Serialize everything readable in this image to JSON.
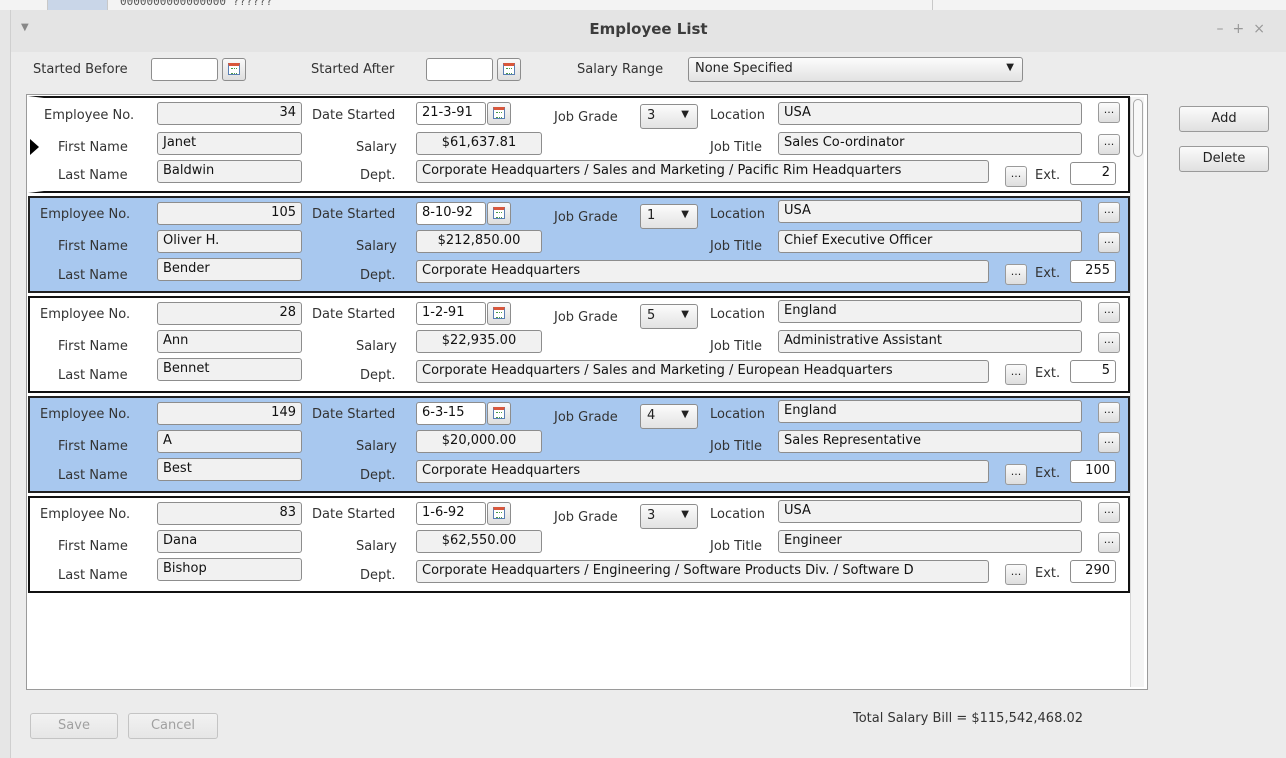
{
  "window": {
    "title": "Employee List",
    "background_fragment": "0000000000000000 ??????"
  },
  "filters": {
    "started_before_label": "Started Before",
    "started_before_value": "",
    "started_after_label": "Started After",
    "started_after_value": "",
    "salary_range_label": "Salary Range",
    "salary_range_value": "None Specified"
  },
  "labels": {
    "employee_no": "Employee No.",
    "first_name": "First Name",
    "last_name": "Last Name",
    "date_started": "Date Started",
    "salary": "Salary",
    "dept": "Dept.",
    "job_grade": "Job Grade",
    "location": "Location",
    "job_title": "Job Title",
    "ext": "Ext.",
    "ellipsis": "..."
  },
  "employees": [
    {
      "emp_no": "34",
      "first_name": "Janet",
      "last_name": "Baldwin",
      "date_started": "21-3-91",
      "salary": "$61,637.81",
      "job_grade": "3",
      "location": "USA",
      "job_title": "Sales Co-ordinator",
      "dept": "Corporate Headquarters / Sales and Marketing / Pacific Rim Headquarters",
      "ext": "2",
      "selected": false
    },
    {
      "emp_no": "105",
      "first_name": "Oliver H.",
      "last_name": "Bender",
      "date_started": "8-10-92",
      "salary": "$212,850.00",
      "job_grade": "1",
      "location": "USA",
      "job_title": "Chief Executive Officer",
      "dept": "Corporate Headquarters",
      "ext": "255",
      "selected": true
    },
    {
      "emp_no": "28",
      "first_name": "Ann",
      "last_name": "Bennet",
      "date_started": "1-2-91",
      "salary": "$22,935.00",
      "job_grade": "5",
      "location": "England",
      "job_title": "Administrative Assistant",
      "dept": "Corporate Headquarters / Sales and Marketing / European Headquarters",
      "ext": "5",
      "selected": false
    },
    {
      "emp_no": "149",
      "first_name": "A",
      "last_name": "Best",
      "date_started": "6-3-15",
      "salary": "$20,000.00",
      "job_grade": "4",
      "location": "England",
      "job_title": "Sales Representative",
      "dept": "Corporate Headquarters",
      "ext": "100",
      "selected": true
    },
    {
      "emp_no": "83",
      "first_name": "Dana",
      "last_name": "Bishop",
      "date_started": "1-6-92",
      "salary": "$62,550.00",
      "job_grade": "3",
      "location": "USA",
      "job_title": "Engineer",
      "dept": "Corporate Headquarters / Engineering / Software Products Div. / Software D",
      "ext": "290",
      "selected": false
    }
  ],
  "buttons": {
    "add": "Add",
    "delete": "Delete",
    "save": "Save",
    "cancel": "Cancel"
  },
  "footer": {
    "total_salary": "Total Salary Bill = $115,542,468.02"
  }
}
